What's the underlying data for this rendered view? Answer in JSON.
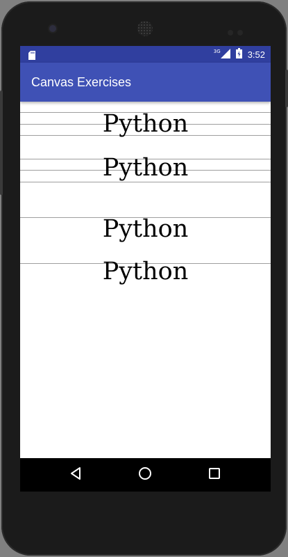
{
  "status_bar": {
    "network_type": "3G",
    "time": "3:52"
  },
  "app_bar": {
    "title": "Canvas Exercises"
  },
  "canvas": {
    "texts": [
      "Python",
      "Python",
      "Python",
      "Python"
    ]
  },
  "icons": {
    "sd_card": "sd-card-icon",
    "signal": "signal-icon",
    "battery": "battery-icon",
    "back": "back-icon",
    "home": "home-icon",
    "recents": "recents-icon"
  },
  "colors": {
    "status_bar": "#303f9f",
    "app_bar": "#3f51b5",
    "nav_bar": "#000000",
    "canvas_background": "#ffffff",
    "guide_line": "#9e9e9e"
  }
}
